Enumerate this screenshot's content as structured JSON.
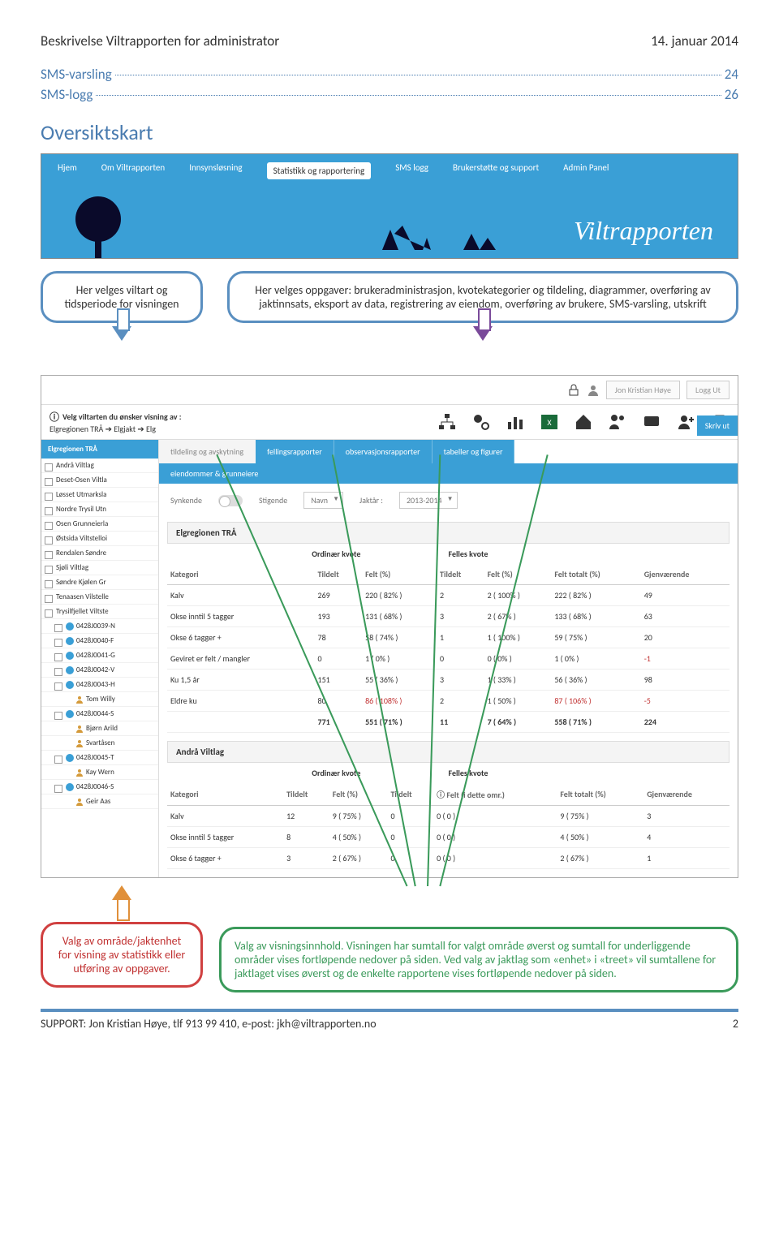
{
  "header": {
    "left": "Beskrivelse Viltrapporten for administrator",
    "right": "14. januar 2014"
  },
  "toc": [
    {
      "label": "SMS-varsling",
      "page": "24"
    },
    {
      "label": "SMS-logg",
      "page": "26"
    }
  ],
  "section_title": "Oversiktskart",
  "banner": {
    "nav": [
      "Hjem",
      "Om Viltrapporten",
      "Innsynsløsning",
      "Statistikk og rapportering",
      "SMS logg",
      "Brukerstøtte og support",
      "Admin Panel"
    ],
    "active_index": 3,
    "logo_text": "Viltrapporten"
  },
  "callouts": {
    "top_left": "Her velges viltart og tidsperiode for visningen",
    "top_right": "Her velges oppgaver: brukeradministrasjon, kvotekategorier og tildeling, diagrammer, overføring av jaktinnsats, eksport av data, registrering av eiendom, overføring av brukere, SMS-varsling, utskrift",
    "bottom_left": "Valg av område/jaktenhet for visning av statistikk eller utføring av oppgaver.",
    "bottom_right": "Valg av visningsinnhold. Visningen har sumtall for valgt område øverst og sumtall for underliggende områder vises fortløpende nedover på siden. Ved valg av jaktlag som «enhet» i «treet» vil sumtallene for jaktlaget vises øverst og de enkelte rapportene vises fortløpende nedover på siden."
  },
  "app": {
    "top_user": "Jon Kristian Høye",
    "top_logout": "Logg Ut",
    "bar_title": "Velg viltarten du ønsker visning av :",
    "bar_path": "Elgregionen TRÅ ➔ Elgjakt ➔ Elg",
    "skriv_ut": "Skriv ut",
    "tabs": [
      "tildeling og avskytning",
      "fellingsrapporter",
      "observasjonsrapporter",
      "tabeller og figurer"
    ],
    "subtab": "eiendommer & grunneiere",
    "controls": {
      "synkende": "Synkende",
      "stigende": "Stigende",
      "navn": "Navn",
      "jaktar_label": "Jaktår :",
      "jaktar_value": "2013-2014"
    },
    "sidebar_head": "Elgregionen TRÅ",
    "tree": [
      {
        "l": "Andrå Viltlag",
        "lvl": 1
      },
      {
        "l": "Deset-Osen Viltla",
        "lvl": 1
      },
      {
        "l": "Løsset Utmarksla",
        "lvl": 1
      },
      {
        "l": "Nordre Trysil Utn",
        "lvl": 1
      },
      {
        "l": "Osen Grunneierla",
        "lvl": 1
      },
      {
        "l": "Østsida Viltstelloi",
        "lvl": 1
      },
      {
        "l": "Rendalen Søndre",
        "lvl": 1
      },
      {
        "l": "Sjøli Viltlag",
        "lvl": 1
      },
      {
        "l": "Søndre Kjølen Gr",
        "lvl": 1
      },
      {
        "l": "Tenaasen Vilstelle",
        "lvl": 1
      },
      {
        "l": "Trysilfjellet Viltste",
        "lvl": 1
      },
      {
        "l": "0428J0039-N",
        "lvl": 2,
        "icon": "disc"
      },
      {
        "l": "0428J0040-F",
        "lvl": 2,
        "icon": "disc"
      },
      {
        "l": "0428J0041-G",
        "lvl": 2,
        "icon": "disc"
      },
      {
        "l": "0428J0042-V",
        "lvl": 2,
        "icon": "disc"
      },
      {
        "l": "0428J0043-H",
        "lvl": 2,
        "icon": "disc"
      },
      {
        "l": "Tom Willy",
        "lvl": 3,
        "icon": "person"
      },
      {
        "l": "0428J0044-S",
        "lvl": 2,
        "icon": "disc"
      },
      {
        "l": "Bjørn Arild",
        "lvl": 3,
        "icon": "person"
      },
      {
        "l": "Svartåsen",
        "lvl": 3,
        "icon": "person"
      },
      {
        "l": "0428J0045-T",
        "lvl": 2,
        "icon": "disc"
      },
      {
        "l": "Kay Wern",
        "lvl": 3,
        "icon": "person"
      },
      {
        "l": "0428J0046-S",
        "lvl": 2,
        "icon": "disc"
      },
      {
        "l": "Geir Aas",
        "lvl": 3,
        "icon": "person"
      }
    ],
    "region1": {
      "name": "Elgregionen TRÅ",
      "sub_ordinaer": "Ordinær kvote",
      "sub_felles": "Felles kvote",
      "cols": [
        "Kategori",
        "Tildelt",
        "Felt (%)",
        "Tildelt",
        "Felt (%)",
        "Felt totalt (%)",
        "Gjenværende"
      ],
      "rows": [
        [
          "Kalv",
          "269",
          "220 ( 82% )",
          "2",
          "2 ( 100% )",
          "222 ( 82% )",
          "49"
        ],
        [
          "Okse inntil 5 tagger",
          "193",
          "131 ( 68% )",
          "3",
          "2 ( 67% )",
          "133 ( 68% )",
          "63"
        ],
        [
          "Okse 6 tagger +",
          "78",
          "58 ( 74% )",
          "1",
          "1 ( 100% )",
          "59 ( 75% )",
          "20"
        ],
        [
          "Geviret er felt / mangler",
          "0",
          "1 ( 0% )",
          "0",
          "0 ( 0% )",
          "1 ( 0% )",
          "-1"
        ],
        [
          "Ku 1,5 år",
          "151",
          "55 ( 36% )",
          "3",
          "1 ( 33% )",
          "56 ( 36% )",
          "98"
        ],
        [
          "Eldre ku",
          "80",
          "86 ( 108% )",
          "2",
          "1 ( 50% )",
          "87 ( 106% )",
          "-5"
        ]
      ],
      "total": [
        "",
        "771",
        "551 ( 71% )",
        "11",
        "7 ( 64% )",
        "558 ( 71% )",
        "224"
      ]
    },
    "region2": {
      "name": "Andrå Viltlag",
      "sub_ordinaer": "Ordinær kvote",
      "sub_felles": "Felles kvote",
      "felt_info": "ⓘ Felt (i dette omr.)",
      "cols": [
        "Kategori",
        "Tildelt",
        "Felt (%)",
        "Tildelt",
        "ⓘ Felt (i dette omr.)",
        "Felt totalt (%)",
        "Gjenværende"
      ],
      "rows": [
        [
          "Kalv",
          "12",
          "9 ( 75% )",
          "0",
          "0 ( 0 )",
          "9 ( 75% )",
          "3"
        ],
        [
          "Okse inntil 5 tagger",
          "8",
          "4 ( 50% )",
          "0",
          "0 ( 0 )",
          "4 ( 50% )",
          "4"
        ],
        [
          "Okse 6 tagger +",
          "3",
          "2 ( 67% )",
          "0",
          "0 ( 0 )",
          "2 ( 67% )",
          "1"
        ]
      ]
    }
  },
  "footer": {
    "left": "SUPPORT: Jon Kristian Høye,  tlf 913 99 410,  e-post: jkh@viltrapporten.no",
    "right": "2"
  }
}
